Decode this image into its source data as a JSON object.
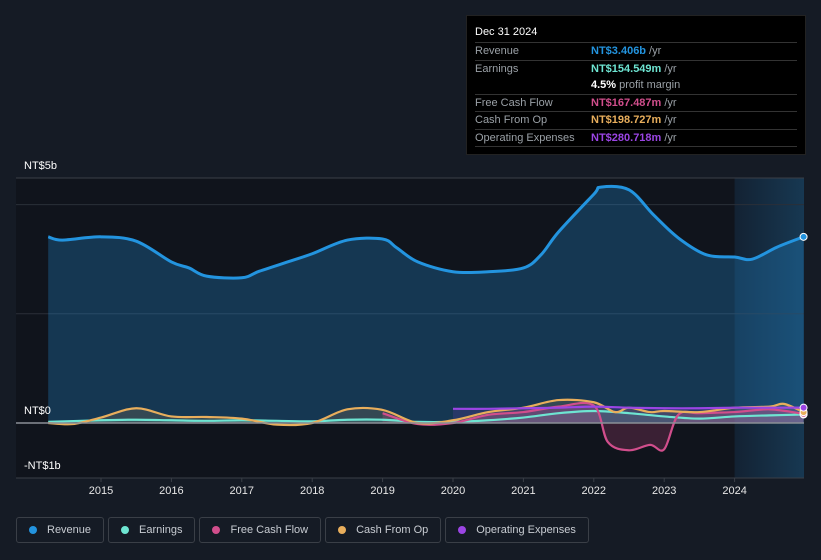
{
  "chart_data": {
    "type": "area",
    "title": "",
    "xlabel": "",
    "ylabel": "",
    "y_axis_labels": [
      "NT$5b",
      "NT$0",
      "-NT$1b"
    ],
    "x_ticks": [
      "2015",
      "2016",
      "2017",
      "2018",
      "2019",
      "2020",
      "2021",
      "2022",
      "2023",
      "2024"
    ],
    "xlim": [
      2014.0,
      2025.0
    ],
    "ylim": [
      -1.0,
      4.5
    ],
    "units": "NT$ billions",
    "forecast_region_start": 2024.0,
    "grid": true,
    "legend_position": "bottom",
    "series": [
      {
        "name": "Revenue",
        "color": "#2394df",
        "x": [
          2014.25,
          2014.45,
          2015.0,
          2015.5,
          2016.0,
          2016.25,
          2016.5,
          2017.0,
          2017.25,
          2017.7,
          2018.0,
          2018.5,
          2019.0,
          2019.2,
          2019.5,
          2020.0,
          2020.5,
          2021.0,
          2021.25,
          2021.5,
          2022.0,
          2022.1,
          2022.5,
          2022.85,
          2023.2,
          2023.6,
          2024.0,
          2024.25,
          2024.6,
          2024.98
        ],
        "values": [
          3.41,
          3.35,
          3.41,
          3.33,
          2.95,
          2.84,
          2.69,
          2.66,
          2.78,
          2.97,
          3.1,
          3.35,
          3.37,
          3.21,
          2.95,
          2.77,
          2.77,
          2.84,
          3.08,
          3.5,
          4.19,
          4.32,
          4.27,
          3.81,
          3.39,
          3.08,
          3.04,
          3.0,
          3.22,
          3.41
        ]
      },
      {
        "name": "Earnings",
        "color": "#6ee5d2",
        "x": [
          2014.25,
          2015.0,
          2015.5,
          2016.0,
          2016.5,
          2017.0,
          2017.5,
          2018.0,
          2018.5,
          2019.0,
          2019.5,
          2020.0,
          2020.5,
          2021.0,
          2021.5,
          2022.0,
          2022.5,
          2023.0,
          2023.5,
          2024.0,
          2024.5,
          2024.98
        ],
        "values": [
          0.02,
          0.05,
          0.06,
          0.05,
          0.04,
          0.05,
          0.04,
          0.03,
          0.06,
          0.06,
          0.02,
          0.02,
          0.05,
          0.1,
          0.18,
          0.22,
          0.18,
          0.12,
          0.08,
          0.12,
          0.14,
          0.155
        ]
      },
      {
        "name": "Free Cash Flow",
        "color": "#d14e8c",
        "x": [
          2019.0,
          2019.5,
          2020.0,
          2020.5,
          2021.0,
          2021.5,
          2022.0,
          2022.2,
          2022.5,
          2022.8,
          2023.0,
          2023.2,
          2023.5,
          2024.0,
          2024.5,
          2024.98
        ],
        "values": [
          0.18,
          -0.02,
          0.0,
          0.15,
          0.2,
          0.3,
          0.32,
          -0.35,
          -0.5,
          -0.4,
          -0.48,
          0.15,
          0.18,
          0.2,
          0.25,
          0.167
        ]
      },
      {
        "name": "Cash From Op",
        "color": "#e8ae5c",
        "x": [
          2014.25,
          2014.6,
          2015.0,
          2015.5,
          2016.0,
          2016.5,
          2017.0,
          2017.5,
          2018.0,
          2018.5,
          2019.0,
          2019.5,
          2020.0,
          2020.5,
          2021.0,
          2021.5,
          2022.0,
          2022.3,
          2022.5,
          2022.8,
          2023.0,
          2023.5,
          2024.0,
          2024.5,
          2024.7,
          2024.98
        ],
        "values": [
          0.0,
          -0.02,
          0.1,
          0.27,
          0.12,
          0.11,
          0.08,
          -0.03,
          0.0,
          0.25,
          0.24,
          0.0,
          0.05,
          0.2,
          0.28,
          0.42,
          0.38,
          0.2,
          0.28,
          0.2,
          0.22,
          0.2,
          0.28,
          0.3,
          0.35,
          0.199
        ]
      },
      {
        "name": "Operating Expenses",
        "color": "#9b45e4",
        "x": [
          2020.0,
          2020.5,
          2021.0,
          2021.5,
          2022.0,
          2022.5,
          2023.0,
          2023.5,
          2024.0,
          2024.5,
          2024.98
        ],
        "values": [
          0.26,
          0.26,
          0.27,
          0.28,
          0.3,
          0.28,
          0.27,
          0.27,
          0.28,
          0.28,
          0.281
        ]
      }
    ]
  },
  "tooltip": {
    "date": "Dec 31 2024",
    "rows": [
      {
        "label": "Revenue",
        "value": "NT$3.406b",
        "unit": "/yr",
        "color": "#2394df"
      },
      {
        "label": "Earnings",
        "value": "NT$154.549m",
        "unit": "/yr",
        "color": "#6ee5d2"
      },
      {
        "label": "",
        "value": "4.5%",
        "unit": "profit margin",
        "color": "#ffffff"
      },
      {
        "label": "Free Cash Flow",
        "value": "NT$167.487m",
        "unit": "/yr",
        "color": "#d14e8c"
      },
      {
        "label": "Cash From Op",
        "value": "NT$198.727m",
        "unit": "/yr",
        "color": "#e8ae5c"
      },
      {
        "label": "Operating Expenses",
        "value": "NT$280.718m",
        "unit": "/yr",
        "color": "#9b45e4"
      }
    ]
  },
  "legend": [
    {
      "label": "Revenue",
      "color": "#2394df"
    },
    {
      "label": "Earnings",
      "color": "#6ee5d2"
    },
    {
      "label": "Free Cash Flow",
      "color": "#d14e8c"
    },
    {
      "label": "Cash From Op",
      "color": "#e8ae5c"
    },
    {
      "label": "Operating Expenses",
      "color": "#9b45e4"
    }
  ]
}
